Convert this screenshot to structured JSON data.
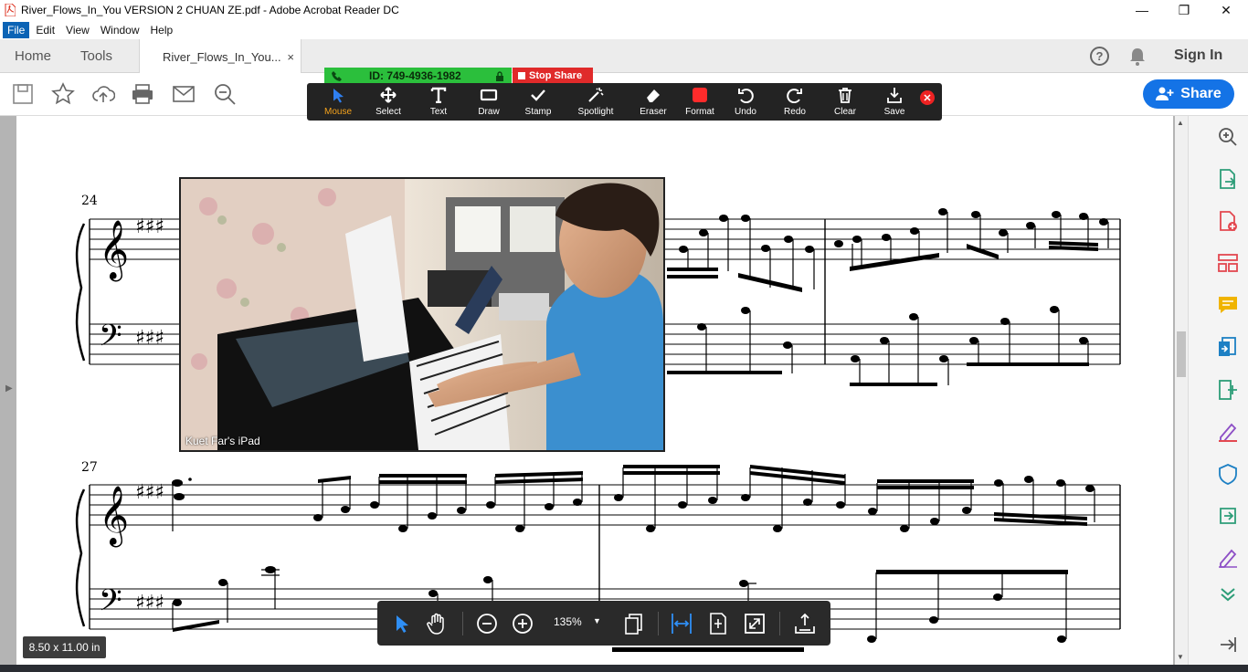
{
  "window": {
    "title": "River_Flows_In_You VERSION 2 CHUAN ZE.pdf - Adobe Acrobat Reader DC",
    "controls": [
      "—",
      "❐",
      "✕"
    ]
  },
  "menu": [
    "File",
    "Edit",
    "View",
    "Window",
    "Help"
  ],
  "tabs": {
    "home": "Home",
    "tools": "Tools",
    "document": "River_Flows_In_You...",
    "close": "×"
  },
  "header": {
    "help": "?",
    "sign_in": "Sign In",
    "share": "Share"
  },
  "toolbar_icons": [
    "save-icon",
    "star-icon",
    "upload-icon",
    "print-icon",
    "mail-icon",
    "search-icon"
  ],
  "zoom_share": {
    "meeting_id": "ID: 749-4936-1982",
    "stop_share": "Stop Share",
    "tools": [
      {
        "label": "Mouse",
        "icon": "cursor-icon"
      },
      {
        "label": "Select",
        "icon": "move-icon"
      },
      {
        "label": "Text",
        "icon": "text-icon"
      },
      {
        "label": "Draw",
        "icon": "rectangle-icon"
      },
      {
        "label": "Stamp",
        "icon": "check-icon"
      },
      {
        "label": "Spotlight",
        "icon": "wand-icon"
      },
      {
        "label": "Eraser",
        "icon": "eraser-icon"
      },
      {
        "label": "Format",
        "icon": "color-swatch-icon"
      },
      {
        "label": "Undo",
        "icon": "undo-icon"
      },
      {
        "label": "Redo",
        "icon": "redo-icon"
      },
      {
        "label": "Clear",
        "icon": "trash-icon"
      },
      {
        "label": "Save",
        "icon": "download-icon"
      }
    ],
    "active_tool": "Mouse",
    "format_color": "#ff2b2b"
  },
  "video": {
    "caption": "Kuet Far's iPad"
  },
  "score": {
    "measure_numbers": [
      "24",
      "27"
    ]
  },
  "float_toolbar": {
    "zoom": "135%"
  },
  "page_size": "8.50 x 11.00 in",
  "colors": {
    "accent": "#1473e6",
    "zoom_green": "#2bbf3c",
    "zoom_red": "#e02a2a",
    "active_orange": "#f4a21c",
    "rail_blue": "#1d80c4",
    "rail_red": "#e34850",
    "rail_green": "#2d9d78",
    "rail_purple": "#8d4fc6"
  }
}
